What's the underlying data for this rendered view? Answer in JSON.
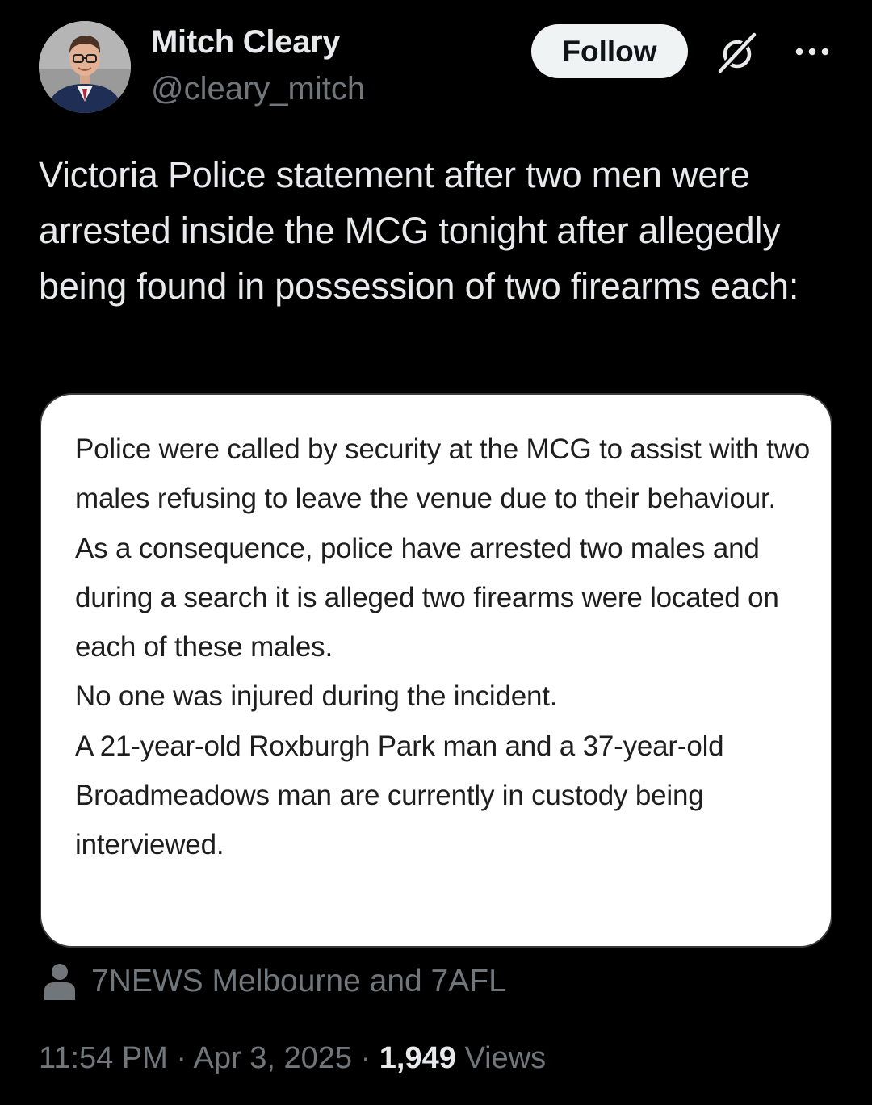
{
  "author": {
    "name": "Mitch Cleary",
    "handle": "@cleary_mitch"
  },
  "actions": {
    "follow_label": "Follow",
    "grok_icon": "grok-icon",
    "more_icon": "more-icon"
  },
  "tweet": {
    "text": "Victoria Police statement after two men were arrested inside the MCG tonight after allegedly being found in possession of two firearms each:"
  },
  "media": {
    "paragraphs": [
      "Police were called by security at the MCG to assist with two males refusing to leave the venue due to their behaviour.",
      "As a consequence, police have arrested two males and during a search it is alleged two firearms were located on each of these males.",
      "No one was injured during the incident.",
      "A 21-year-old Roxburgh Park man and a 37-year-old Broadmeadows man are currently in custody being interviewed."
    ]
  },
  "tagged": {
    "icon": "person-icon",
    "text": "7NEWS Melbourne and 7AFL"
  },
  "meta": {
    "time": "11:54 PM",
    "separator": "·",
    "date": "Apr 3, 2025",
    "views_count": "1,949",
    "views_label": "Views"
  },
  "colors": {
    "background": "#000000",
    "primary_text": "#e7e9ea",
    "secondary_text": "#71767b",
    "follow_bg": "#eff3f4",
    "card_bg": "#ffffff"
  }
}
